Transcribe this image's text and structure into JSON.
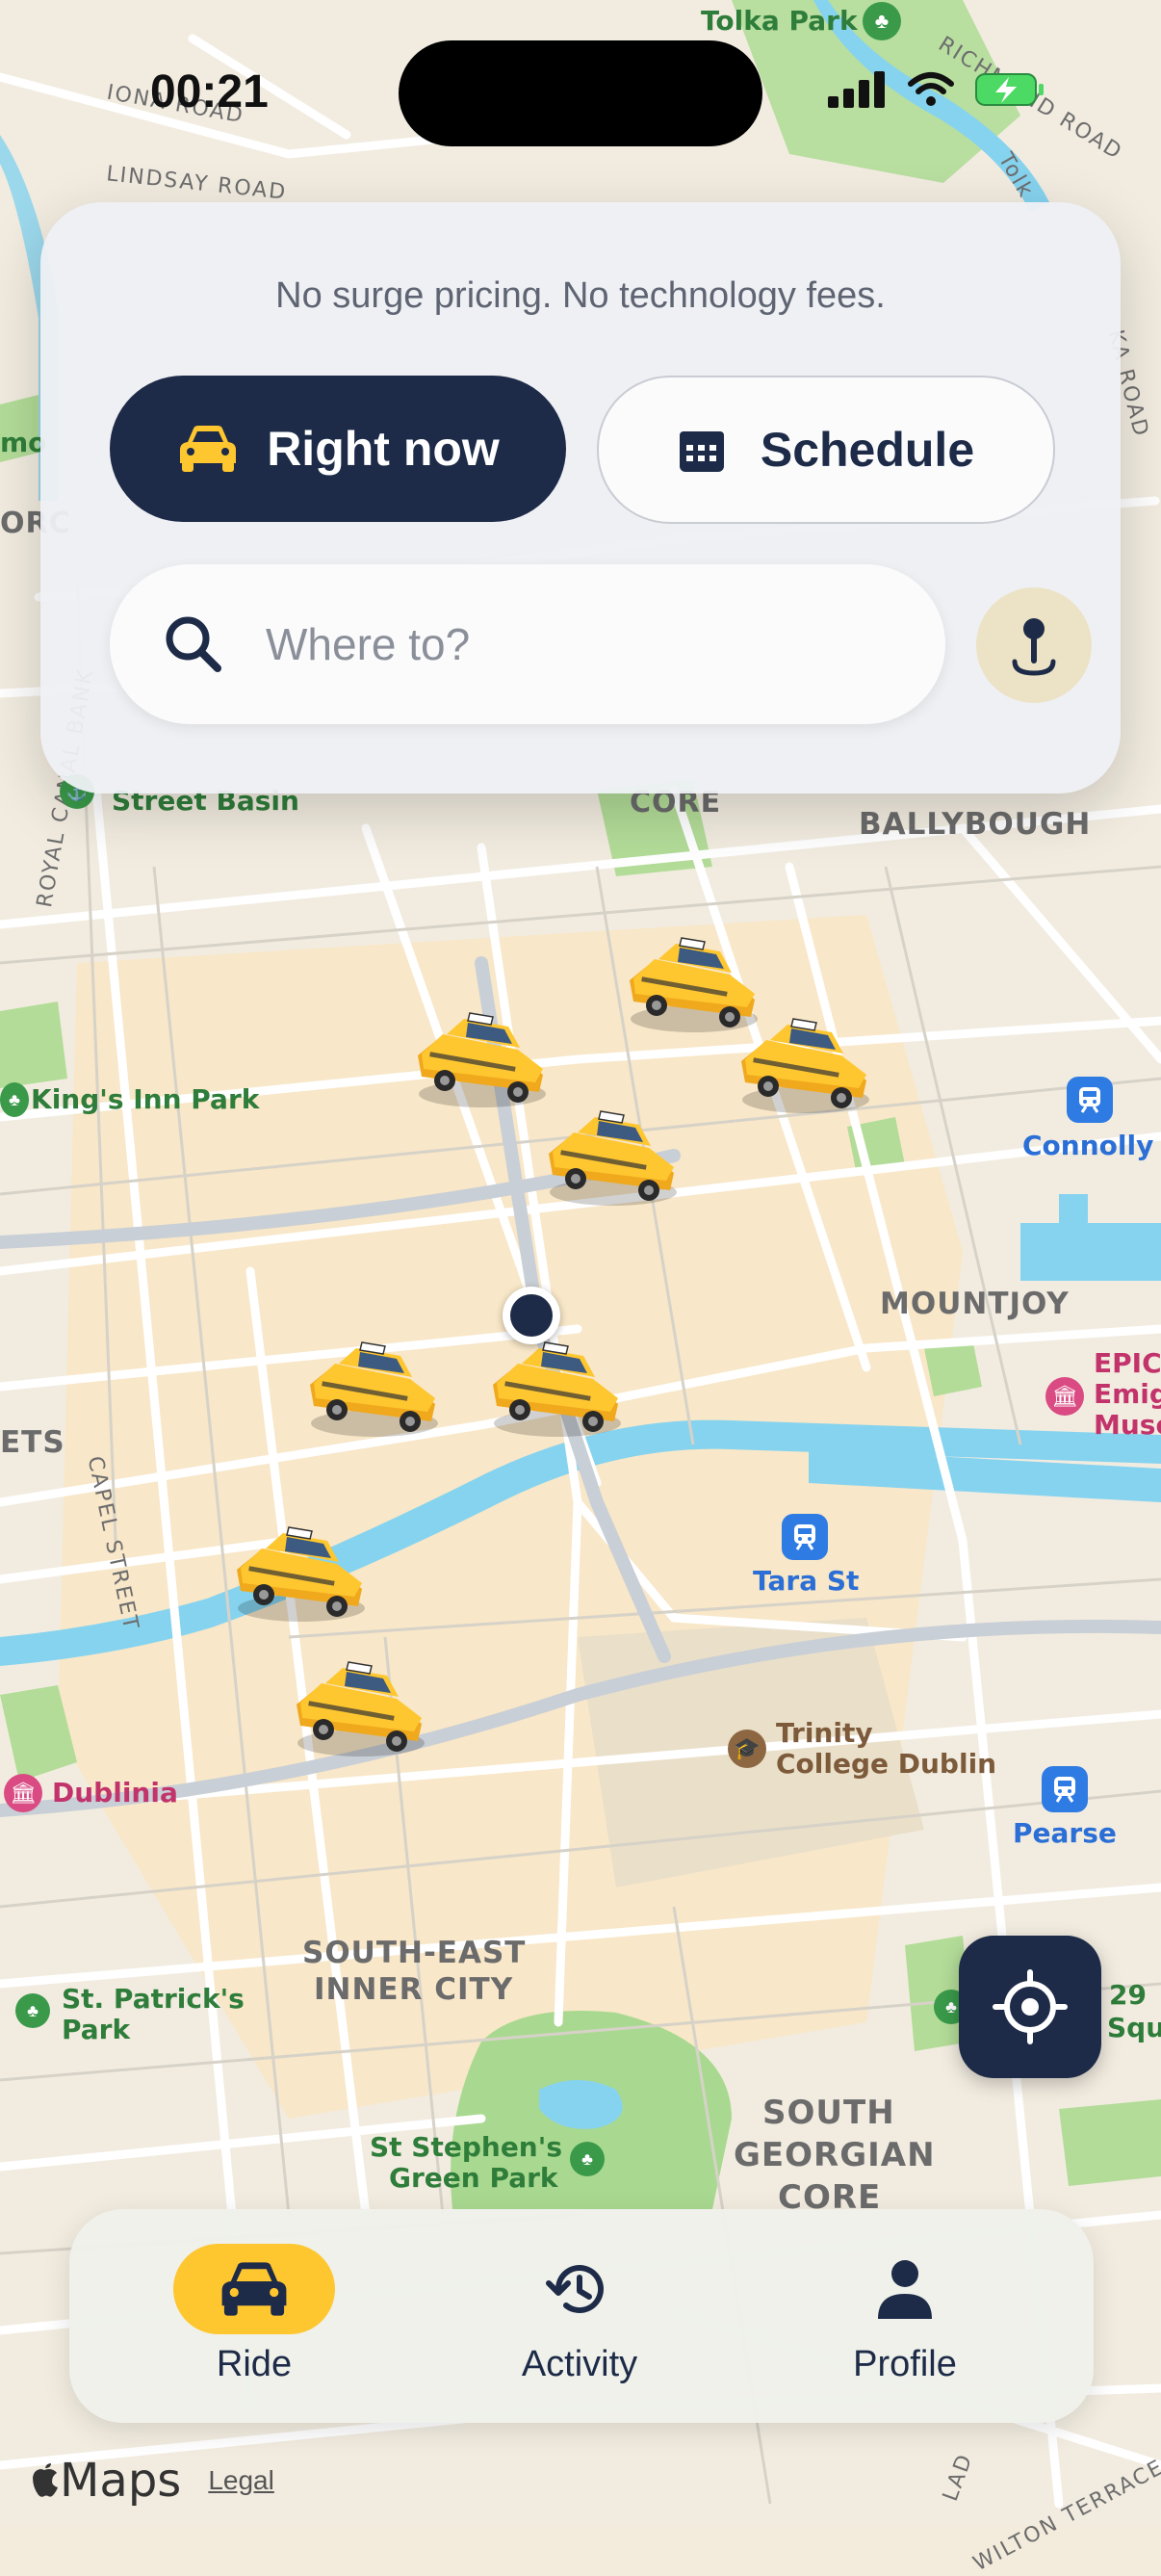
{
  "status_bar": {
    "time": "00:21"
  },
  "map": {
    "districts": [
      "BALLYBOUGH",
      "MOUNTJOY",
      "SOUTH-EAST",
      "INNER CITY",
      "SOUTH",
      "GEORGIAN",
      "CORE",
      "CORE",
      "ETS",
      "ORC"
    ],
    "roads": [
      "IONA ROAD",
      "LINDSAY ROAD",
      "RICHMOND ROAD",
      "CAPEL STREET",
      "ROYAL CANAL BANK",
      "WILTON TERRACE",
      "LAD",
      "KA ROAD",
      "Tolk"
    ],
    "parks": [
      "Tolka Park",
      "Street Basin",
      "King's Inn Park",
      "St. Patrick's",
      "Park",
      "St Stephen's",
      "Green Park",
      "29",
      "Squ",
      "mo"
    ],
    "stations": [
      "Connolly",
      "Tara St",
      "Pearse"
    ],
    "pois": [
      "EPIC",
      "Emig",
      "Muse",
      "Trinity",
      "College Dublin",
      "Dublinia"
    ]
  },
  "top_card": {
    "tagline": "No surge pricing. No technology fees.",
    "right_now_label": "Right now",
    "schedule_label": "Schedule",
    "search_placeholder": "Where to?"
  },
  "tabs": [
    {
      "label": "Ride",
      "icon": "car-icon",
      "active": true
    },
    {
      "label": "Activity",
      "icon": "history-icon",
      "active": false
    },
    {
      "label": "Profile",
      "icon": "person-icon",
      "active": false
    }
  ],
  "map_credit": {
    "brand": "Maps",
    "legal": "Legal"
  },
  "colors": {
    "navy": "#1d2b48",
    "accent_yellow": "#fec62f",
    "water": "#86d3ef",
    "park": "#a9d990"
  }
}
